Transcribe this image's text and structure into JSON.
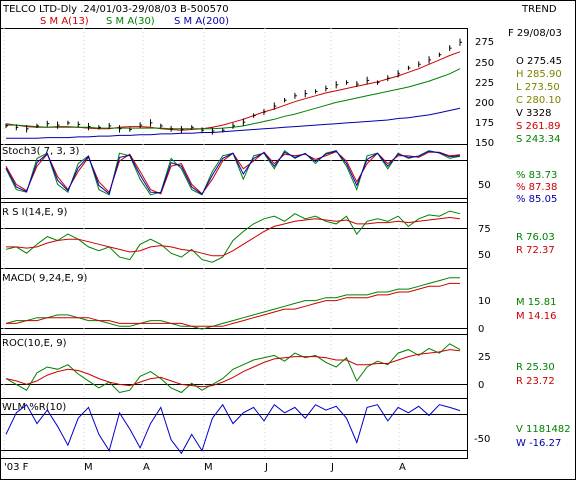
{
  "header": {
    "title": "TELCO LTD-Dly .24/01/03-29/08/03  B-500570",
    "trend": "TREND",
    "sma13": "S M A(13)",
    "sma30": "S M A(30)",
    "sma200": "S M A(200)"
  },
  "colors": {
    "price": "#000000",
    "sma13": "#cc0000",
    "sma30": "#008000",
    "sma200": "#0000aa",
    "pctK": "#008000",
    "pctD": "#cc0000",
    "pctBlue": "#0000cc",
    "label_dark": "#000000",
    "label_olive": "#808000",
    "label_red": "#cc0000",
    "label_green": "#008000",
    "label_blue": "#0000aa"
  },
  "quote": {
    "date": "F 29/08/03",
    "open": "O   275.45",
    "high": "H   285.90",
    "low": "L   273.50",
    "close": "C   280.10",
    "volume": "V     3328",
    "sma_red": "S   261.89",
    "sma_green": "S   243.34"
  },
  "panels": {
    "stoch": {
      "label": "Stoch3( 7, 3, 3)",
      "pct_k": "%   83.73",
      "pct_d": "%   87.38",
      "pct_blue": "%   85.05"
    },
    "rsi": {
      "label": "R S I(14,E, 9)",
      "r1": "R    76.03",
      "r2": "R    72.37"
    },
    "macd": {
      "label": "MACD( 9,24,E, 9)",
      "m1": "M    15.81",
      "m2": "M    14.16"
    },
    "roc": {
      "label": "ROC(10,E, 9)",
      "r1": "R    25.30",
      "r2": "R    23.72"
    },
    "wlm": {
      "label": "WLM %R(10)",
      "v": "V 1181482",
      "w": "W   -16.27"
    }
  },
  "x_axis": {
    "labels": [
      "'03 F",
      "M",
      "A",
      "M",
      "J",
      "J",
      "A"
    ]
  },
  "chart_data": [
    {
      "type": "line",
      "panel": "price",
      "ylim": [
        140,
        290
      ],
      "yticks": [
        "275",
        "250",
        "225",
        "200",
        "175",
        "150"
      ],
      "series": [
        {
          "name": "S M A(13)",
          "values": [
            165,
            163,
            161,
            160,
            160,
            161,
            161,
            160,
            159,
            158,
            158,
            160,
            161,
            161,
            160,
            158,
            157,
            156,
            157,
            158,
            160,
            163,
            167,
            171,
            176,
            181,
            185,
            190,
            195,
            199,
            203,
            207,
            210,
            213,
            216,
            219,
            222,
            226,
            230,
            235,
            240,
            246,
            252,
            258,
            263
          ]
        },
        {
          "name": "S M A(30)",
          "values": [
            163,
            163,
            162,
            161,
            160,
            160,
            160,
            160,
            160,
            159,
            159,
            159,
            159,
            159,
            159,
            159,
            158,
            158,
            158,
            158,
            158,
            159,
            160,
            162,
            165,
            168,
            171,
            175,
            178,
            182,
            186,
            190,
            194,
            197,
            200,
            203,
            206,
            209,
            212,
            215,
            219,
            223,
            228,
            233,
            240
          ]
        },
        {
          "name": "S M A(200)",
          "values": [
            145,
            145,
            145,
            145,
            146,
            146,
            146,
            147,
            147,
            148,
            148,
            149,
            149,
            150,
            150,
            151,
            151,
            152,
            152,
            153,
            153,
            154,
            155,
            156,
            157,
            158,
            159,
            160,
            161,
            162,
            163,
            164,
            165,
            166,
            167,
            168,
            169,
            170,
            172,
            173,
            175,
            177,
            180,
            183,
            186
          ]
        }
      ],
      "price": [
        162,
        160,
        158,
        162,
        165,
        163,
        166,
        164,
        161,
        160,
        162,
        158,
        157,
        163,
        166,
        162,
        158,
        157,
        160,
        156,
        155,
        156,
        162,
        167,
        176,
        181,
        189,
        197,
        203,
        206,
        209,
        213,
        218,
        221,
        219,
        224,
        221,
        227,
        233,
        241,
        246,
        252,
        259,
        268,
        276
      ]
    },
    {
      "type": "line",
      "panel": "stoch",
      "ylim": [
        0,
        100
      ],
      "yticks": [
        "50"
      ],
      "series": [
        {
          "name": "%",
          "values": [
            60,
            20,
            15,
            80,
            90,
            30,
            15,
            70,
            85,
            20,
            10,
            90,
            85,
            40,
            10,
            15,
            80,
            60,
            20,
            10,
            55,
            85,
            90,
            40,
            85,
            90,
            60,
            95,
            80,
            90,
            70,
            90,
            95,
            65,
            20,
            85,
            90,
            60,
            90,
            80,
            85,
            95,
            90,
            80,
            84
          ]
        },
        {
          "name": "%",
          "values": [
            65,
            30,
            18,
            65,
            88,
            45,
            20,
            55,
            82,
            35,
            15,
            75,
            88,
            55,
            20,
            12,
            65,
            70,
            30,
            12,
            40,
            75,
            90,
            60,
            75,
            92,
            70,
            88,
            85,
            88,
            78,
            85,
            93,
            75,
            35,
            70,
            90,
            70,
            85,
            85,
            82,
            92,
            92,
            85,
            87
          ]
        },
        {
          "name": "%",
          "values": [
            62,
            25,
            16,
            72,
            89,
            38,
            18,
            62,
            84,
            28,
            12,
            82,
            86,
            48,
            15,
            14,
            72,
            65,
            25,
            11,
            48,
            80,
            90,
            50,
            80,
            91,
            65,
            92,
            82,
            89,
            74,
            88,
            94,
            70,
            28,
            78,
            90,
            65,
            88,
            82,
            84,
            94,
            91,
            83,
            85
          ]
        }
      ]
    },
    {
      "type": "line",
      "panel": "rsi",
      "ylim": [
        35,
        82
      ],
      "yticks": [
        "75",
        "50"
      ],
      "series": [
        {
          "name": "R",
          "values": [
            48,
            50,
            45,
            52,
            58,
            55,
            60,
            56,
            50,
            47,
            50,
            42,
            40,
            52,
            56,
            52,
            45,
            42,
            48,
            40,
            38,
            42,
            55,
            62,
            68,
            72,
            74,
            70,
            76,
            72,
            74,
            70,
            68,
            74,
            60,
            70,
            72,
            70,
            74,
            66,
            72,
            75,
            74,
            78,
            76
          ]
        },
        {
          "name": "R",
          "values": [
            50,
            50,
            49,
            50,
            53,
            55,
            56,
            56,
            54,
            52,
            50,
            48,
            46,
            47,
            50,
            51,
            50,
            48,
            47,
            45,
            43,
            43,
            47,
            52,
            57,
            62,
            66,
            68,
            70,
            71,
            72,
            71,
            70,
            71,
            68,
            68,
            69,
            69,
            70,
            69,
            70,
            71,
            72,
            73,
            72
          ]
        }
      ]
    },
    {
      "type": "line",
      "panel": "macd",
      "ylim": [
        -3,
        18
      ],
      "yticks": [
        "10",
        "0"
      ],
      "series": [
        {
          "name": "M",
          "values": [
            0,
            1,
            1,
            2,
            2,
            3,
            3,
            2,
            1,
            1,
            0,
            -1,
            -1,
            0,
            1,
            1,
            0,
            -1,
            -1,
            -2,
            -1,
            0,
            1,
            2,
            3,
            4,
            5,
            6,
            7,
            8,
            8,
            9,
            9,
            10,
            10,
            10,
            11,
            11,
            12,
            12,
            13,
            14,
            15,
            16,
            16
          ]
        },
        {
          "name": "M",
          "values": [
            0,
            0,
            1,
            1,
            2,
            2,
            2,
            2,
            2,
            1,
            1,
            0,
            0,
            0,
            0,
            0,
            0,
            0,
            -1,
            -1,
            -1,
            -1,
            0,
            1,
            2,
            3,
            4,
            5,
            5,
            6,
            7,
            8,
            8,
            9,
            9,
            9,
            10,
            10,
            11,
            11,
            12,
            13,
            13,
            14,
            14
          ]
        }
      ]
    },
    {
      "type": "line",
      "panel": "roc",
      "ylim": [
        -15,
        35
      ],
      "yticks": [
        "25",
        "0"
      ],
      "series": [
        {
          "name": "R",
          "values": [
            0,
            -5,
            -10,
            5,
            10,
            8,
            12,
            4,
            -2,
            -8,
            -3,
            -12,
            -10,
            2,
            6,
            0,
            -8,
            -12,
            -4,
            -10,
            -5,
            0,
            8,
            12,
            16,
            18,
            20,
            15,
            22,
            18,
            20,
            14,
            10,
            18,
            -2,
            10,
            15,
            12,
            22,
            25,
            20,
            26,
            22,
            30,
            25
          ]
        },
        {
          "name": "R",
          "values": [
            0,
            -2,
            -5,
            -2,
            3,
            6,
            8,
            7,
            4,
            0,
            -3,
            -5,
            -6,
            -3,
            0,
            1,
            -2,
            -5,
            -6,
            -7,
            -6,
            -3,
            1,
            6,
            10,
            14,
            17,
            18,
            19,
            19,
            19,
            18,
            16,
            16,
            12,
            12,
            13,
            13,
            16,
            19,
            21,
            22,
            23,
            25,
            24
          ]
        }
      ]
    },
    {
      "type": "line",
      "panel": "wlm",
      "ylim": [
        -100,
        0
      ],
      "yticks": [
        "-50"
      ],
      "series": [
        {
          "name": "W",
          "values": [
            -60,
            -20,
            -5,
            -40,
            -15,
            -45,
            -80,
            -30,
            -10,
            -60,
            -90,
            -20,
            -50,
            -85,
            -40,
            -10,
            -70,
            -95,
            -60,
            -90,
            -30,
            -5,
            -40,
            -20,
            -10,
            -35,
            -5,
            -20,
            -10,
            -30,
            -5,
            -15,
            -8,
            -30,
            -75,
            -10,
            -5,
            -35,
            -10,
            -20,
            -8,
            -25,
            -5,
            -10,
            -16
          ]
        }
      ]
    }
  ]
}
